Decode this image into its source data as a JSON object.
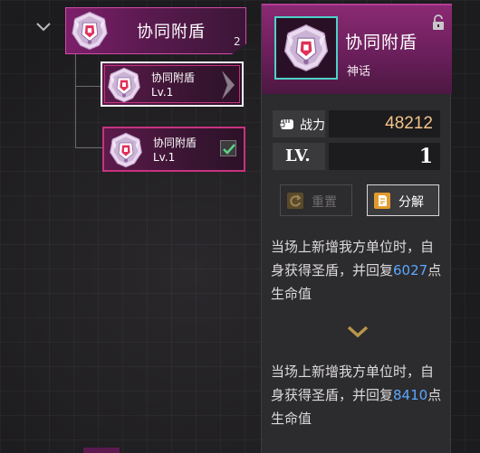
{
  "tree": {
    "group": {
      "title": "协同附盾",
      "count": "2",
      "icon": "shield-emblem-icon",
      "expanded": true
    },
    "items": [
      {
        "name": "协同附盾",
        "level": "Lv.1",
        "selected": true,
        "equipped": false
      },
      {
        "name": "协同附盾",
        "level": "Lv.1",
        "selected": false,
        "equipped": true
      }
    ]
  },
  "detail": {
    "name": "协同附盾",
    "rarity": "神话",
    "locked": false,
    "power_label": "战力",
    "power_value": "48212",
    "level_label": "LV.",
    "level_value": "1",
    "buttons": {
      "reset": "重置",
      "disassemble": "分解"
    },
    "current_effect": {
      "prefix": "当场上新增我方单位时，自身获得圣盾，并回复",
      "value": "6027",
      "suffix": "点生命值"
    },
    "next_effect": {
      "prefix": "当场上新增我方单位时，自身获得圣盾，并回复",
      "value": "8410",
      "suffix": "点生命值"
    }
  },
  "colors": {
    "accent_magenta": "#c8327f",
    "power_gold": "#f2c48a",
    "highlight_blue": "#5aa8ff",
    "frame_teal": "#4fd1c8"
  }
}
